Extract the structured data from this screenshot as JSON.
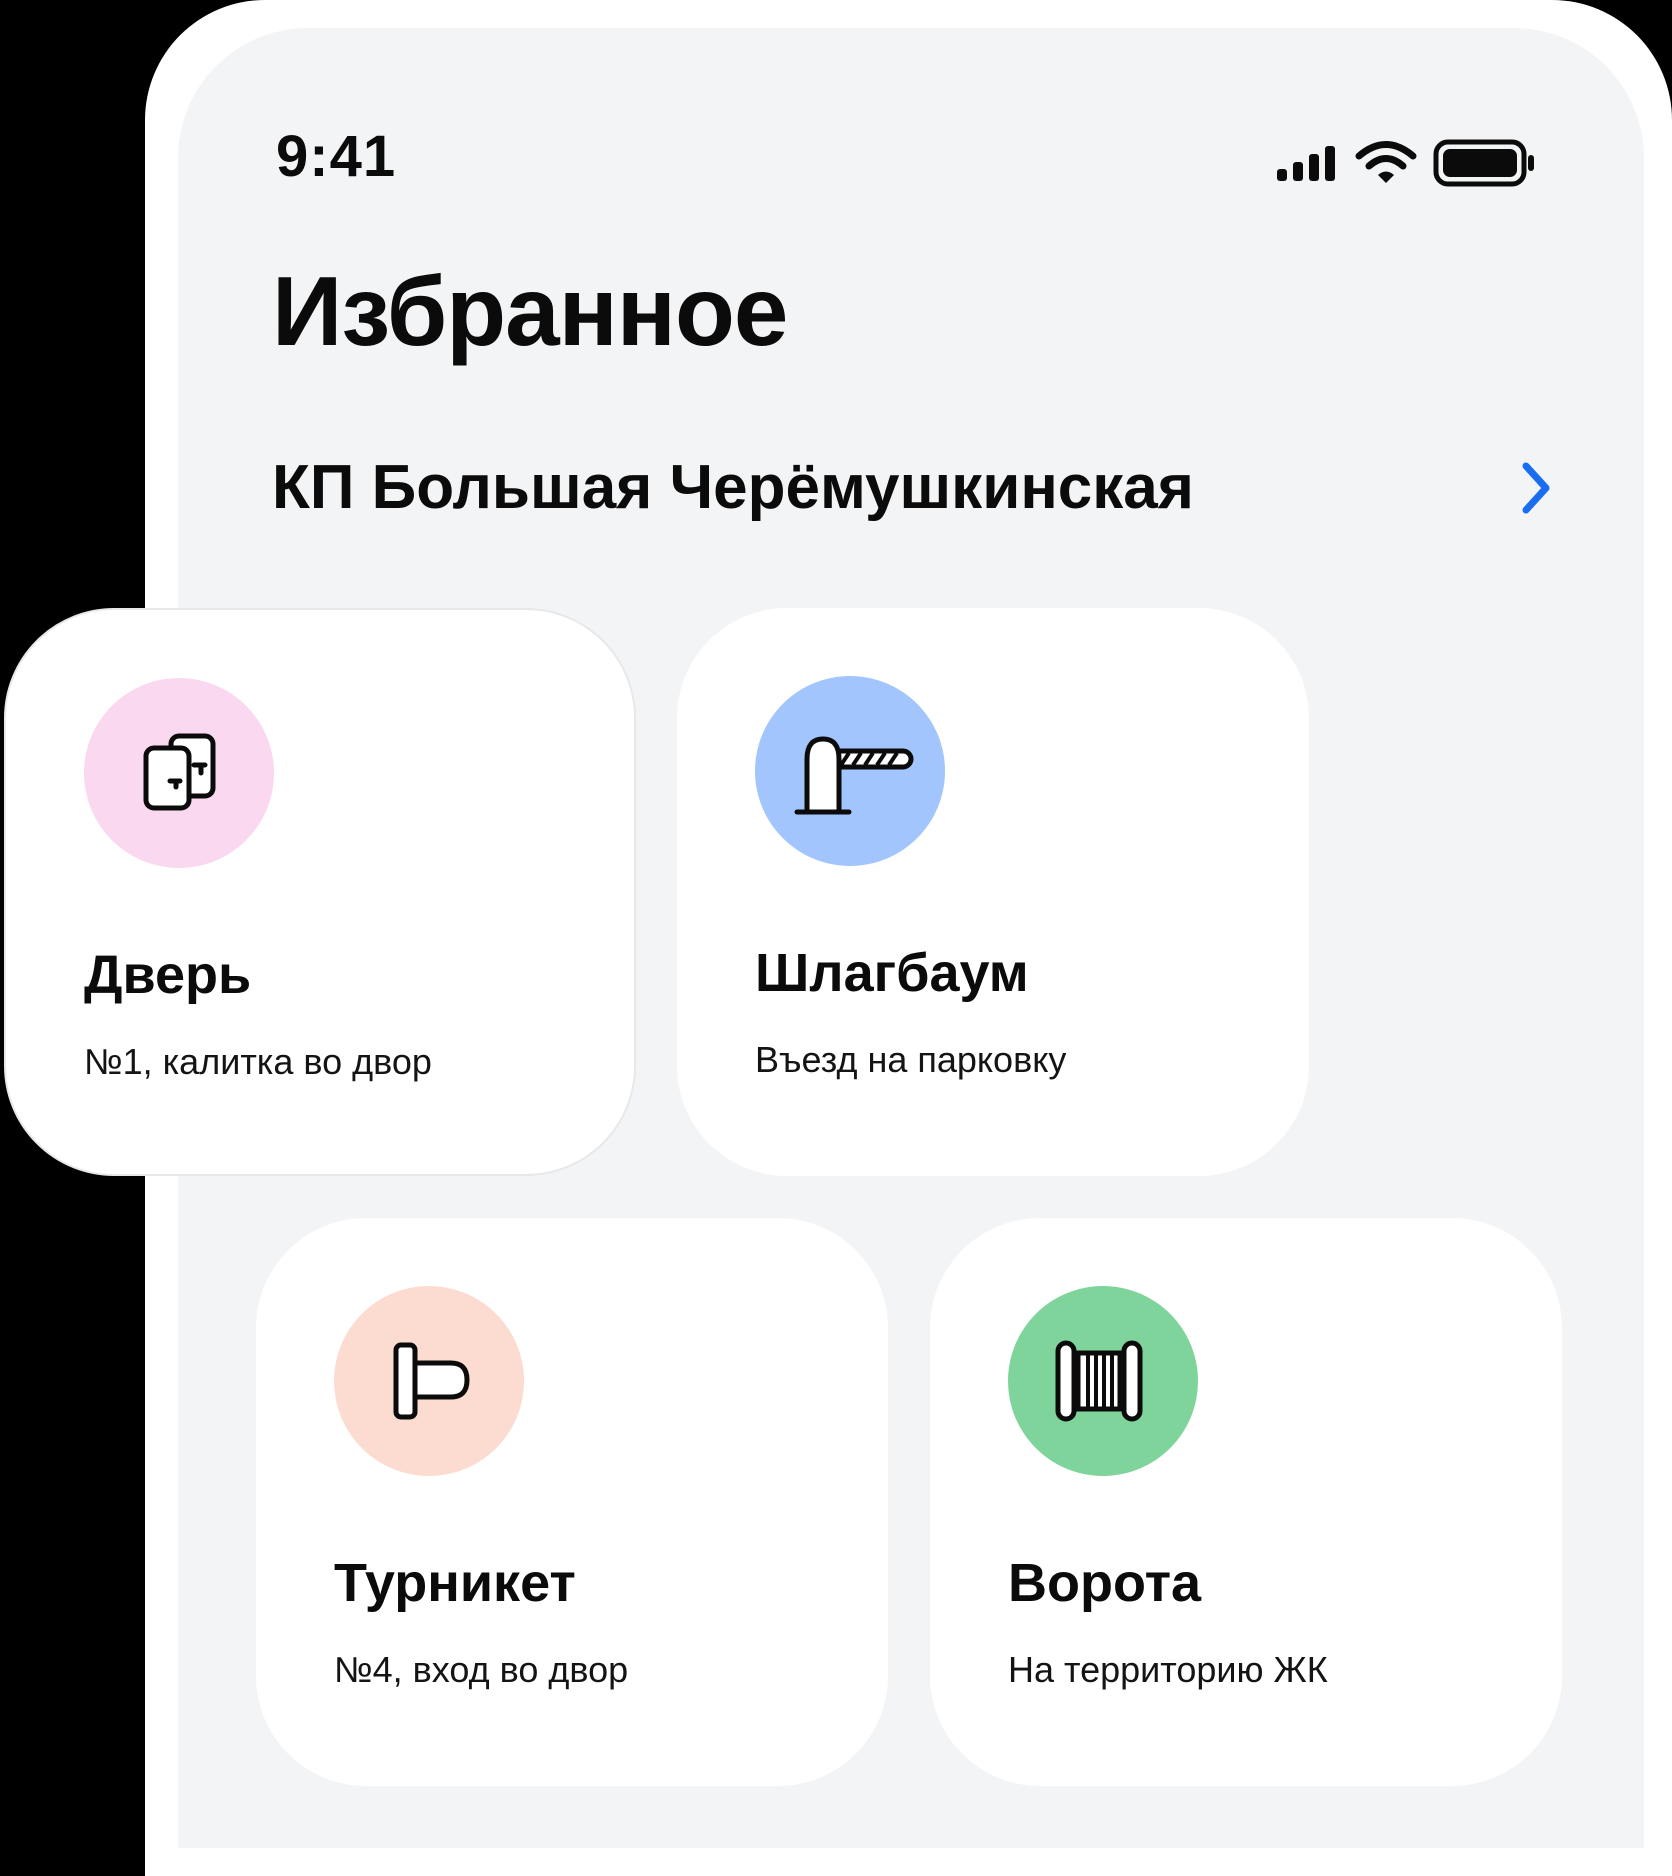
{
  "status_bar": {
    "time": "9:41",
    "icons": [
      "cellular-signal-icon",
      "wifi-icon",
      "battery-icon"
    ]
  },
  "header": {
    "title": "Избранное"
  },
  "location": {
    "name": "КП Большая Черёмушкинская",
    "chevron_icon": "chevron-right-icon",
    "accent_color": "#1a6cf0"
  },
  "devices": [
    {
      "title": "Дверь",
      "subtitle": "№1, калитка во двор",
      "icon": "door-icon",
      "color": "#fad8ef"
    },
    {
      "title": "Шлагбаум",
      "subtitle": "Въезд на парковку",
      "icon": "barrier-icon",
      "color": "#a1c5fc"
    },
    {
      "title": "Турникет",
      "subtitle": "№4, вход во двор",
      "icon": "turnstile-icon",
      "color": "#fcdcd0"
    },
    {
      "title": "Ворота",
      "subtitle": "На территорию ЖК",
      "icon": "gate-icon",
      "color": "#7fd49c"
    }
  ]
}
